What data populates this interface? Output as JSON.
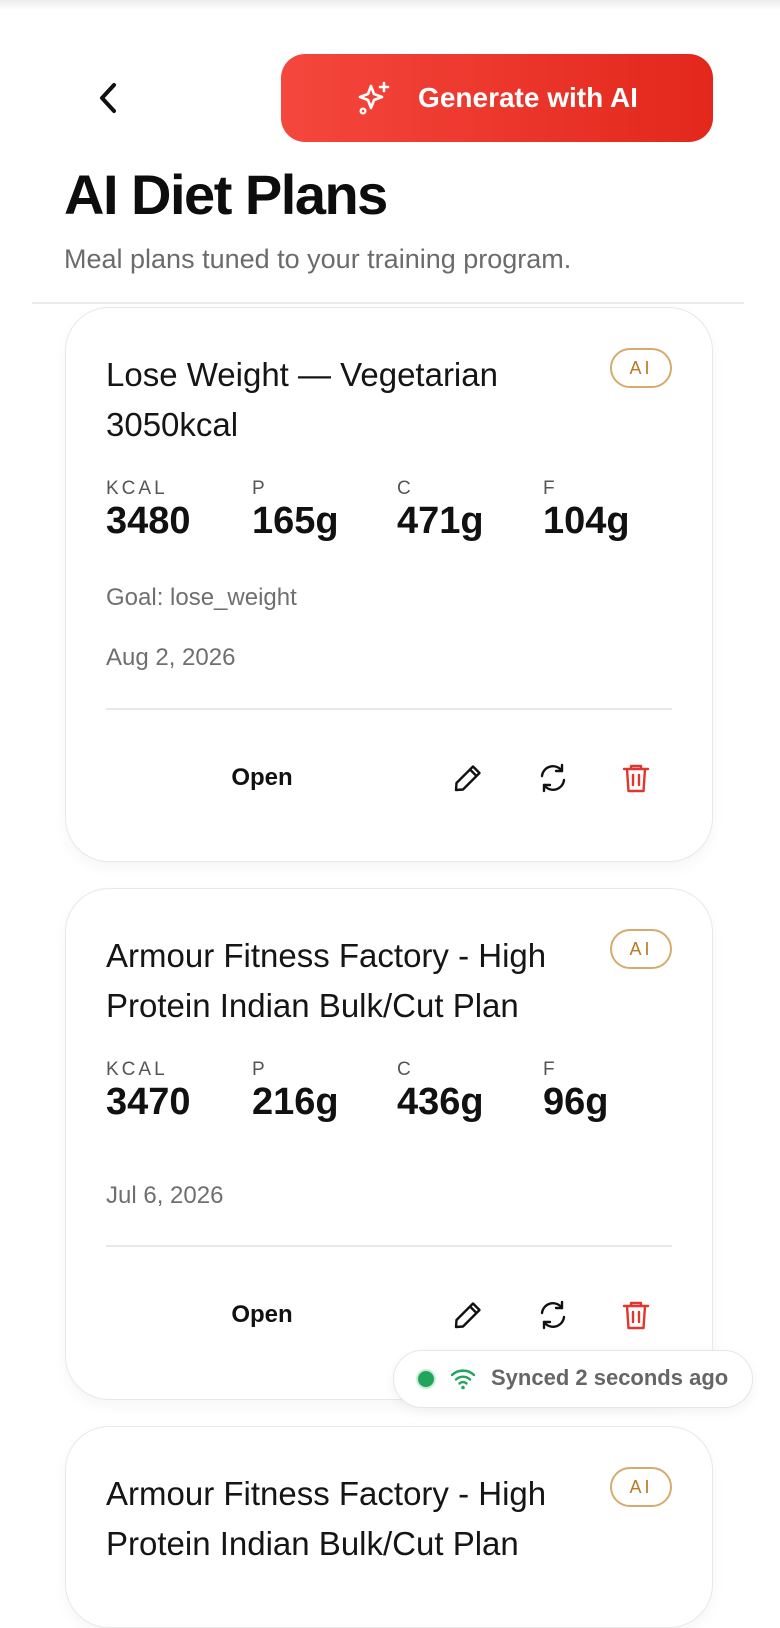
{
  "header": {
    "back_icon": "chevron-left-icon",
    "generate_label": "Generate with AI",
    "generate_icon": "sparkles-icon",
    "accent_color": "#e8342a",
    "title": "AI Diet Plans",
    "subtitle": "Meal plans tuned to your training program."
  },
  "plans": [
    {
      "title": "Lose Weight — Vegetarian 3050kcal",
      "badge": "AI",
      "macros": [
        {
          "label": "KCAL",
          "value": "3480"
        },
        {
          "label": "P",
          "value": "165g"
        },
        {
          "label": "C",
          "value": "471g"
        },
        {
          "label": "F",
          "value": "104g"
        }
      ],
      "goal": "Goal: lose_weight",
      "date": "Aug 2, 2026",
      "open_label": "Open"
    },
    {
      "title": "Armour Fitness Factory - High Protein Indian Bulk/Cut Plan",
      "badge": "AI",
      "macros": [
        {
          "label": "KCAL",
          "value": "3470"
        },
        {
          "label": "P",
          "value": "216g"
        },
        {
          "label": "C",
          "value": "436g"
        },
        {
          "label": "F",
          "value": "96g"
        }
      ],
      "date": "Jul 6, 2026",
      "open_label": "Open"
    },
    {
      "title": "Armour Fitness Factory - High Protein Indian Bulk/Cut Plan",
      "badge": "AI"
    }
  ],
  "sync": {
    "text": "Synced 2 seconds ago",
    "status_color": "#22a55b",
    "icon": "wifi-icon"
  },
  "action_icons": [
    "pencil-icon",
    "refresh-icon",
    "trash-icon"
  ],
  "delete_color": "#e0362c"
}
